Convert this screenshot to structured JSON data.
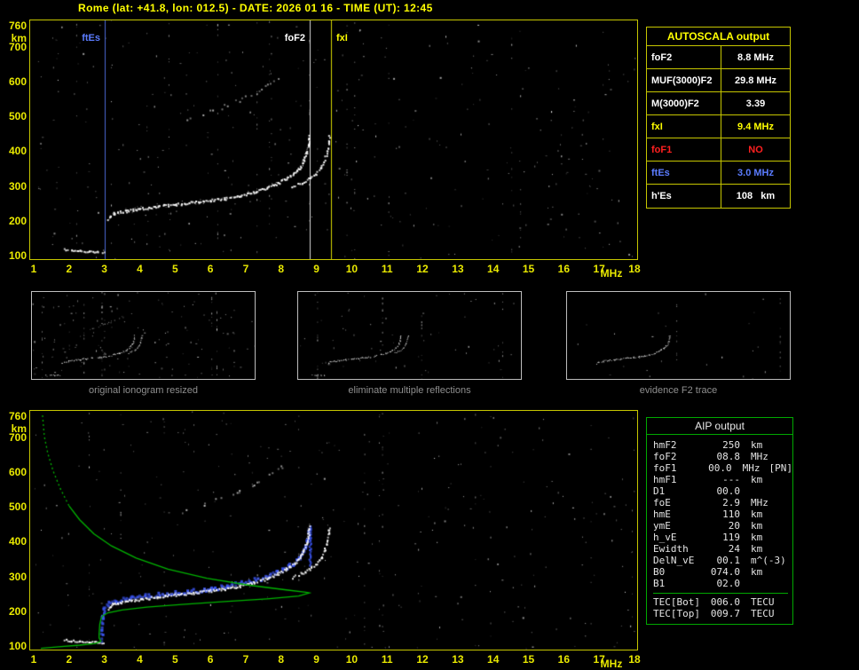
{
  "title": "Rome (lat: +41.8, lon: 012.5) - DATE: 2026 01 16 - TIME (UT): 12:45",
  "autoscala_table": {
    "title": "AUTOSCALA output",
    "rows": [
      {
        "label": "foF2",
        "value": "8.8 MHz",
        "color": "#ffffff"
      },
      {
        "label": "MUF(3000)F2",
        "value": "29.8 MHz",
        "color": "#ffffff"
      },
      {
        "label": "M(3000)F2",
        "value": "3.39",
        "color": "#ffffff"
      },
      {
        "label": "fxI",
        "value": "9.4 MHz",
        "color": "#ffff00"
      },
      {
        "label": "foF1",
        "value": "NO",
        "color": "#ff2020"
      },
      {
        "label": "ftEs",
        "value": "3.0 MHz",
        "color": "#5b7cff"
      },
      {
        "label": "h'Es",
        "value": "108   km",
        "color": "#ffffff"
      }
    ]
  },
  "thumbnails": [
    {
      "caption": "original ionogram resized"
    },
    {
      "caption": "eliminate multiple reflections"
    },
    {
      "caption": "evidence F2 trace"
    }
  ],
  "aip_table": {
    "title": "AIP output",
    "rows": [
      {
        "label": "hmF2",
        "value": "250",
        "unit": "km"
      },
      {
        "label": "foF2",
        "value": "08.8",
        "unit": "MHz"
      },
      {
        "label": "foF1",
        "value": "00.0",
        "unit": "MHz",
        "extra": "[PN]"
      },
      {
        "label": "hmF1",
        "value": "---",
        "unit": "km"
      },
      {
        "label": "D1",
        "value": "00.0",
        "unit": ""
      },
      {
        "label": "foE",
        "value": "2.9",
        "unit": "MHz"
      },
      {
        "label": "hmE",
        "value": "110",
        "unit": "km"
      },
      {
        "label": "ymE",
        "value": "20",
        "unit": "km"
      },
      {
        "label": "h_vE",
        "value": "119",
        "unit": "km"
      },
      {
        "label": "Ewidth",
        "value": "24",
        "unit": "km"
      },
      {
        "label": "DelN_vE",
        "value": "00.1",
        "unit": "m^(-3)"
      },
      {
        "label": "B0",
        "value": "074.0",
        "unit": "km"
      },
      {
        "label": "B1",
        "value": "02.0",
        "unit": ""
      }
    ],
    "tec_rows": [
      {
        "label": "TEC[Bot]",
        "value": "006.0",
        "unit": "TECU"
      },
      {
        "label": "TEC[Top]",
        "value": "009.7",
        "unit": "TECU"
      }
    ]
  },
  "chart_data": {
    "type": "scatter",
    "description": "Vertical-incidence ionogram: virtual height (km) vs sounding frequency (MHz); shown twice (raw with AUTOSCALA markers, and with AIP fitted trace + electron density profile)",
    "xlabel": "MHz",
    "ylabel": "km",
    "xlim": [
      1,
      18
    ],
    "ylim": [
      100,
      760
    ],
    "x_ticks": [
      1,
      2,
      3,
      4,
      5,
      6,
      7,
      8,
      9,
      10,
      11,
      12,
      13,
      14,
      15,
      16,
      17,
      18
    ],
    "y_ticks": [
      760,
      700,
      600,
      500,
      400,
      300,
      200,
      100
    ],
    "profile_color": "#00b400",
    "markers": [
      {
        "label": "ftEs",
        "freq_mhz": 3.0,
        "color": "#5b7cff"
      },
      {
        "label": "foF2",
        "freq_mhz": 8.8,
        "color": "#ffffff"
      },
      {
        "label": "fxI",
        "freq_mhz": 9.4,
        "color": "#ffff00"
      }
    ],
    "traces": {
      "es_layer": [
        [
          1.85,
          117
        ],
        [
          2.05,
          114
        ],
        [
          2.3,
          112
        ],
        [
          2.55,
          111
        ],
        [
          2.8,
          110
        ],
        [
          2.97,
          109
        ]
      ],
      "f_ordinary": [
        [
          3.1,
          205
        ],
        [
          3.15,
          214
        ],
        [
          3.25,
          220
        ],
        [
          3.6,
          227
        ],
        [
          4.0,
          233
        ],
        [
          4.5,
          240
        ],
        [
          5.0,
          246
        ],
        [
          5.5,
          252
        ],
        [
          6.0,
          258
        ],
        [
          6.4,
          263
        ],
        [
          6.8,
          271
        ],
        [
          7.2,
          281
        ],
        [
          7.6,
          293
        ],
        [
          7.9,
          307
        ],
        [
          8.15,
          321
        ],
        [
          8.35,
          335
        ],
        [
          8.5,
          351
        ],
        [
          8.62,
          371
        ],
        [
          8.71,
          395
        ],
        [
          8.76,
          419
        ],
        [
          8.78,
          442
        ]
      ],
      "f_extraordinary": [
        [
          8.3,
          296
        ],
        [
          8.55,
          307
        ],
        [
          8.78,
          319
        ],
        [
          8.98,
          335
        ],
        [
          9.12,
          353
        ],
        [
          9.22,
          375
        ],
        [
          9.29,
          399
        ],
        [
          9.33,
          423
        ],
        [
          9.35,
          441
        ]
      ],
      "second_hop_multiple": [
        [
          5.3,
          492
        ],
        [
          5.8,
          507
        ],
        [
          6.3,
          524
        ],
        [
          6.8,
          544
        ],
        [
          7.2,
          564
        ],
        [
          7.6,
          588
        ],
        [
          7.9,
          607
        ],
        [
          8.1,
          620
        ]
      ]
    },
    "fitted_trace_blue": [
      [
        2.9,
        118
      ],
      [
        2.9,
        155
      ],
      [
        2.92,
        185
      ],
      [
        2.95,
        206
      ],
      [
        3.1,
        222
      ],
      [
        3.3,
        231
      ],
      [
        3.7,
        238
      ],
      [
        4.2,
        244
      ],
      [
        5.0,
        252
      ],
      [
        6.0,
        264
      ],
      [
        7.0,
        284
      ],
      [
        7.6,
        300
      ],
      [
        8.0,
        318
      ],
      [
        8.3,
        337
      ],
      [
        8.5,
        357
      ],
      [
        8.65,
        381
      ],
      [
        8.74,
        410
      ],
      [
        8.78,
        440
      ]
    ],
    "profile_green": [
      [
        1.25,
        760
      ],
      [
        1.3,
        700
      ],
      [
        1.4,
        650
      ],
      [
        1.55,
        600
      ],
      [
        1.75,
        550
      ],
      [
        2.0,
        500
      ],
      [
        2.3,
        460
      ],
      [
        2.7,
        420
      ],
      [
        3.2,
        385
      ],
      [
        3.9,
        350
      ],
      [
        4.8,
        318
      ],
      [
        5.9,
        292
      ],
      [
        7.1,
        272
      ],
      [
        8.2,
        258
      ],
      [
        8.7,
        252
      ],
      [
        8.8,
        250
      ],
      [
        8.5,
        241
      ],
      [
        7.6,
        233
      ],
      [
        6.4,
        225
      ],
      [
        5.2,
        217
      ],
      [
        4.2,
        209
      ],
      [
        3.5,
        201
      ],
      [
        3.1,
        193
      ],
      [
        2.95,
        184
      ],
      [
        2.9,
        174
      ],
      [
        2.87,
        160
      ],
      [
        2.86,
        146
      ],
      [
        2.85,
        132
      ],
      [
        2.85,
        121
      ],
      [
        2.9,
        111
      ],
      [
        2.75,
        105
      ],
      [
        2.3,
        100
      ],
      [
        1.7,
        95
      ],
      [
        1.2,
        91
      ]
    ]
  }
}
